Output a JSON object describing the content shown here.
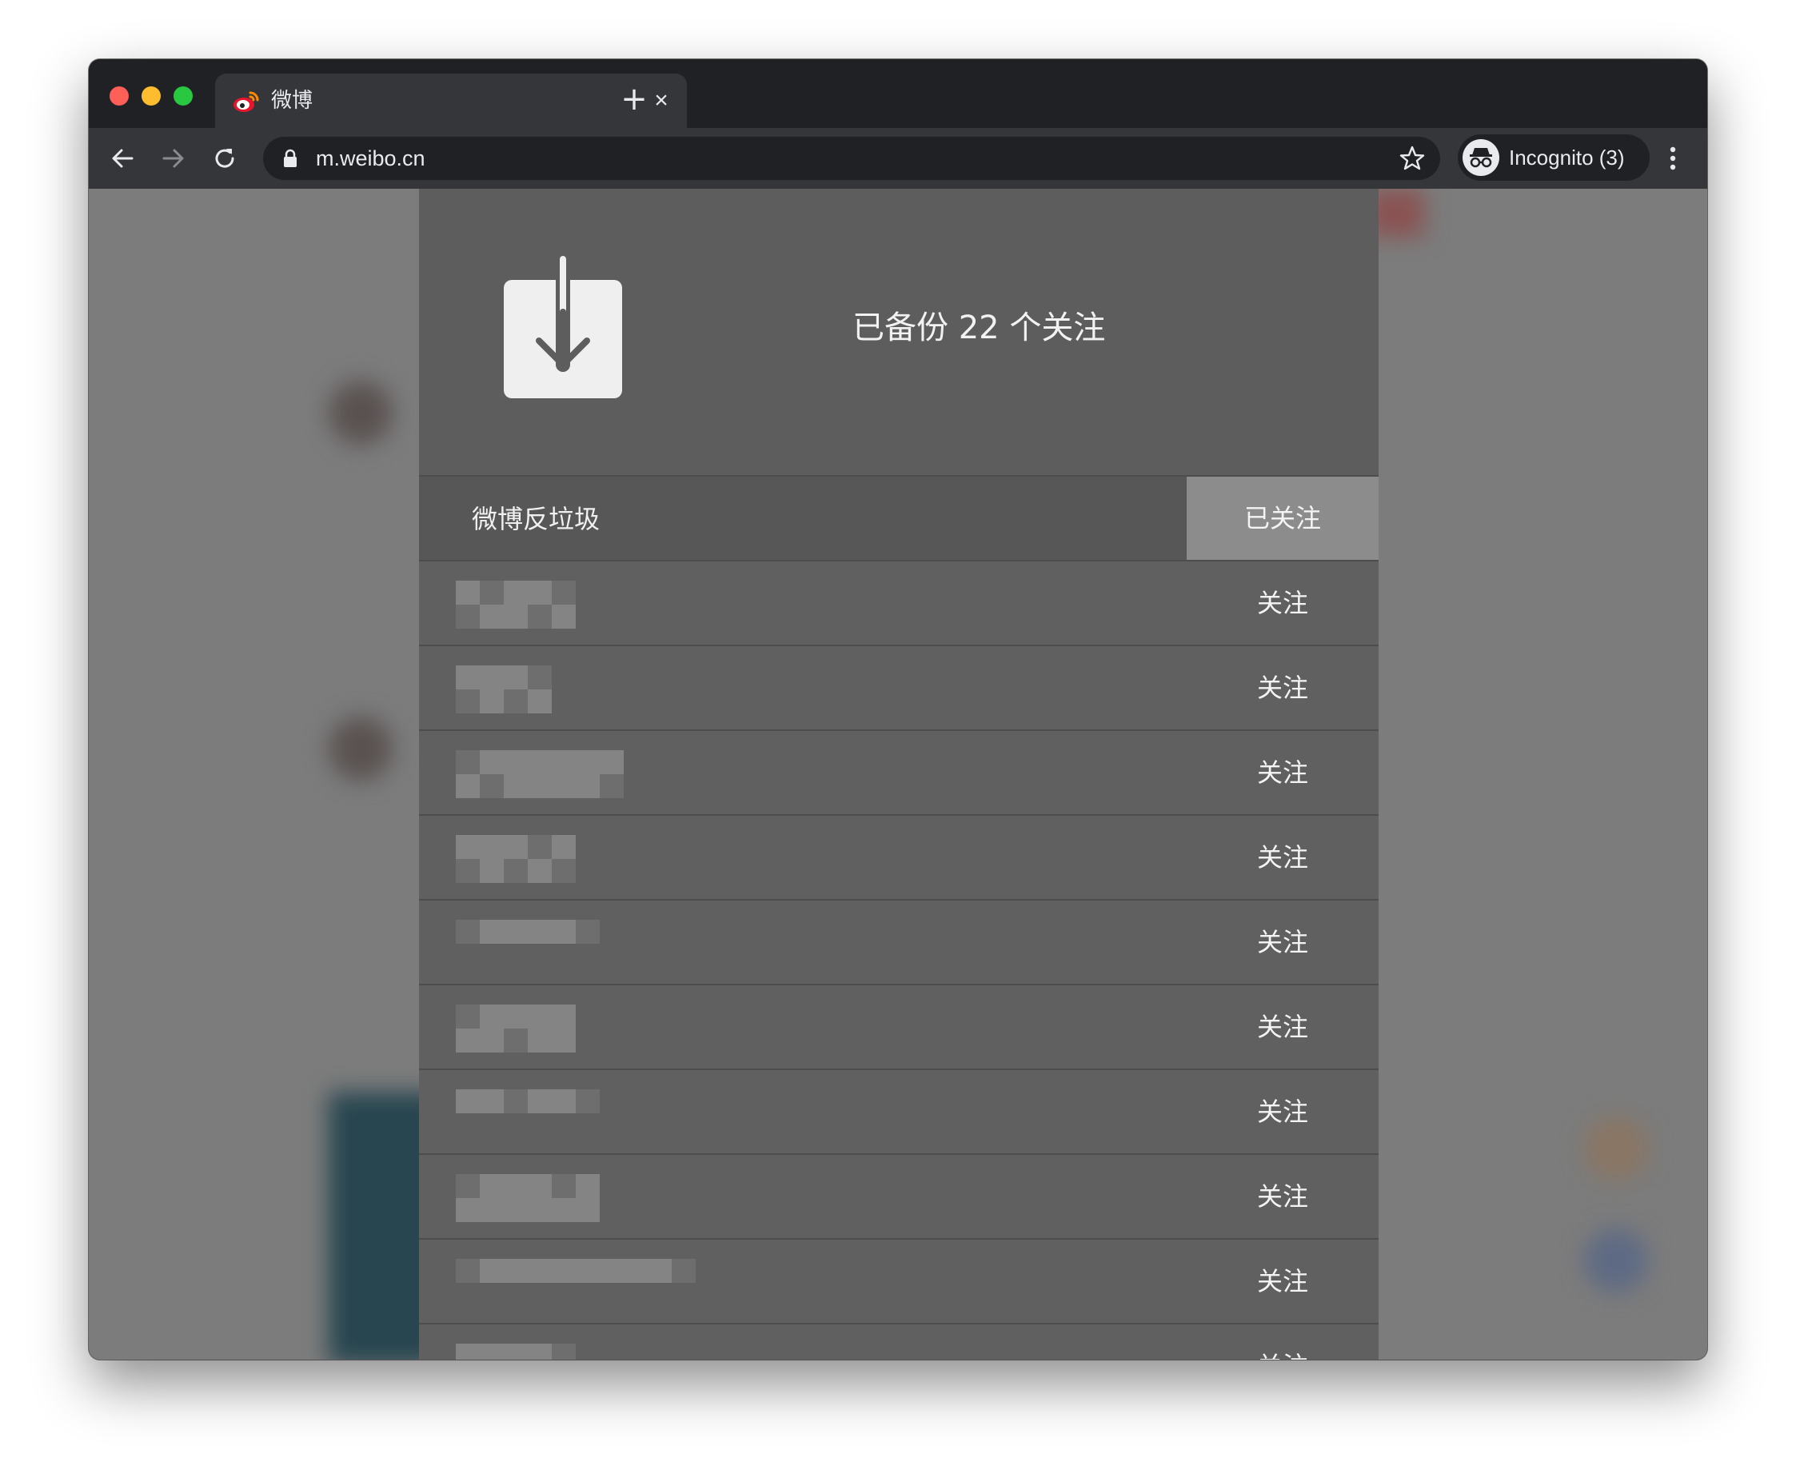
{
  "browser": {
    "tab_title": "微博",
    "tab_close_glyph": "×",
    "new_tab_glyph": "+",
    "url": "m.weibo.cn",
    "profile_label": "Incognito (3)",
    "icons": [
      "back-arrow-icon",
      "forward-arrow-icon",
      "reload-icon",
      "lock-icon",
      "star-icon",
      "incognito-icon",
      "more-vert-icon",
      "weibo-favicon"
    ]
  },
  "backup": {
    "summary": "已备份 22 个关注",
    "icon": "download-icon"
  },
  "follow_list": [
    {
      "name": "微博反垃圾",
      "button": "已关注",
      "followed": true,
      "name_hidden": false
    },
    {
      "name": "",
      "button": "关注",
      "followed": false,
      "name_hidden": true
    },
    {
      "name": "",
      "button": "关注",
      "followed": false,
      "name_hidden": true
    },
    {
      "name": "",
      "button": "关注",
      "followed": false,
      "name_hidden": true
    },
    {
      "name": "",
      "button": "关注",
      "followed": false,
      "name_hidden": true
    },
    {
      "name": "",
      "button": "关注",
      "followed": false,
      "name_hidden": true
    },
    {
      "name": "",
      "button": "关注",
      "followed": false,
      "name_hidden": true
    },
    {
      "name": "",
      "button": "关注",
      "followed": false,
      "name_hidden": true
    },
    {
      "name": "",
      "button": "关注",
      "followed": false,
      "name_hidden": true
    },
    {
      "name": "",
      "button": "关注",
      "followed": false,
      "name_hidden": true
    },
    {
      "name": "",
      "button": "关注",
      "followed": false,
      "name_hidden": true
    }
  ],
  "colors": {
    "chrome_dark": "#202124",
    "chrome_toolbar": "#35363a",
    "overlay_gray": "#7c7c7c",
    "panel_gray": "#606060",
    "followed_button": "#8c8c8c",
    "close_red": "#fe5f57",
    "minimize_yellow": "#febc2e",
    "zoom_green": "#28c840"
  }
}
